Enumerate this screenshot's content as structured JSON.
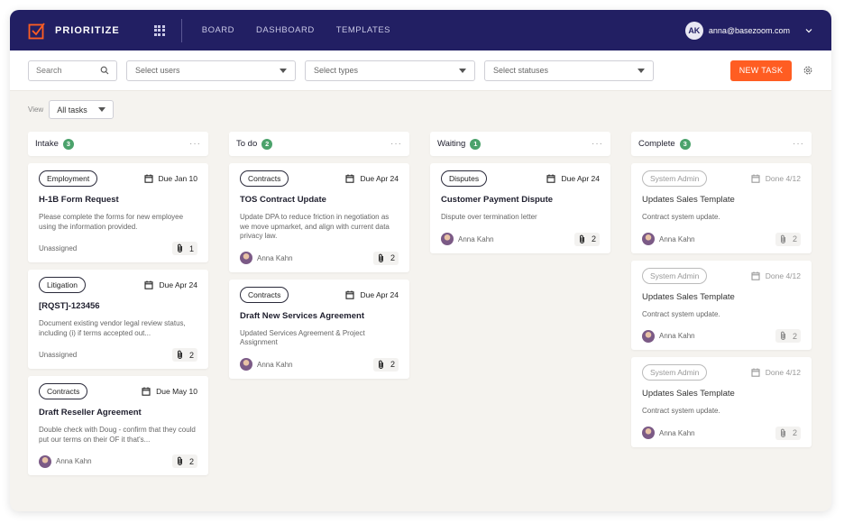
{
  "nav": {
    "brand": "PRIORITIZE",
    "links": [
      "BOARD",
      "DASHBOARD",
      "TEMPLATES"
    ],
    "user_initials": "AK",
    "user_email": "anna@basezoom.com"
  },
  "filters": {
    "search_placeholder": "Search",
    "users_placeholder": "Select users",
    "types_placeholder": "Select types",
    "statuses_placeholder": "Select statuses",
    "new_task_label": "NEW TASK"
  },
  "view": {
    "label": "View",
    "value": "All tasks"
  },
  "colors": {
    "nav_bg": "#221f63",
    "accent": "#ff5d22",
    "count_badge": "#4ba26b",
    "board_bg": "#f5f3ef"
  },
  "columns": [
    {
      "title": "Intake",
      "count": "3",
      "cards": [
        {
          "tag": "Employment",
          "due": "Due Jan 10",
          "title": "H-1B Form Request",
          "desc": "Please complete the forms for new employee using the information provided.",
          "assignee": "Unassigned",
          "attachments": "1"
        },
        {
          "tag": "Litigation",
          "due": "Due Apr 24",
          "title": "[RQST]-123456",
          "desc": "Document existing vendor legal review status, including (i) if terms accepted out...",
          "assignee": "Unassigned",
          "attachments": "2"
        },
        {
          "tag": "Contracts",
          "due": "Due May 10",
          "title": "Draft Reseller Agreement",
          "desc": "Double check with Doug - confirm that they could put our terms on their OF it that's...",
          "assignee": "Anna Kahn",
          "attachments": "2"
        }
      ]
    },
    {
      "title": "To do",
      "count": "2",
      "cards": [
        {
          "tag": "Contracts",
          "due": "Due Apr 24",
          "title": "TOS Contract Update",
          "desc": "Update DPA to reduce friction in negotiation as we move upmarket, and align with current data privacy law.",
          "assignee": "Anna Kahn",
          "attachments": "2"
        },
        {
          "tag": "Contracts",
          "due": "Due Apr 24",
          "title": "Draft New Services Agreement",
          "desc": "Updated Services Agreement & Project Assignment",
          "assignee": "Anna Kahn",
          "attachments": "2"
        }
      ]
    },
    {
      "title": "Waiting",
      "count": "1",
      "cards": [
        {
          "tag": "Disputes",
          "due": "Due Apr 24",
          "title": "Customer Payment Dispute",
          "desc": "Dispute over termination letter",
          "assignee": "Anna Kahn",
          "attachments": "2"
        }
      ]
    },
    {
      "title": "Complete",
      "count": "3",
      "cards": [
        {
          "tag": "System Admin",
          "due": "Done 4/12",
          "title": "Updates Sales Template",
          "desc": "Contract system update.",
          "assignee": "Anna Kahn",
          "attachments": "2"
        },
        {
          "tag": "System Admin",
          "due": "Done 4/12",
          "title": "Updates Sales Template",
          "desc": "Contract system update.",
          "assignee": "Anna Kahn",
          "attachments": "2"
        },
        {
          "tag": "System Admin",
          "due": "Done 4/12",
          "title": "Updates Sales Template",
          "desc": "Contract system update.",
          "assignee": "Anna Kahn",
          "attachments": "2"
        }
      ]
    }
  ]
}
